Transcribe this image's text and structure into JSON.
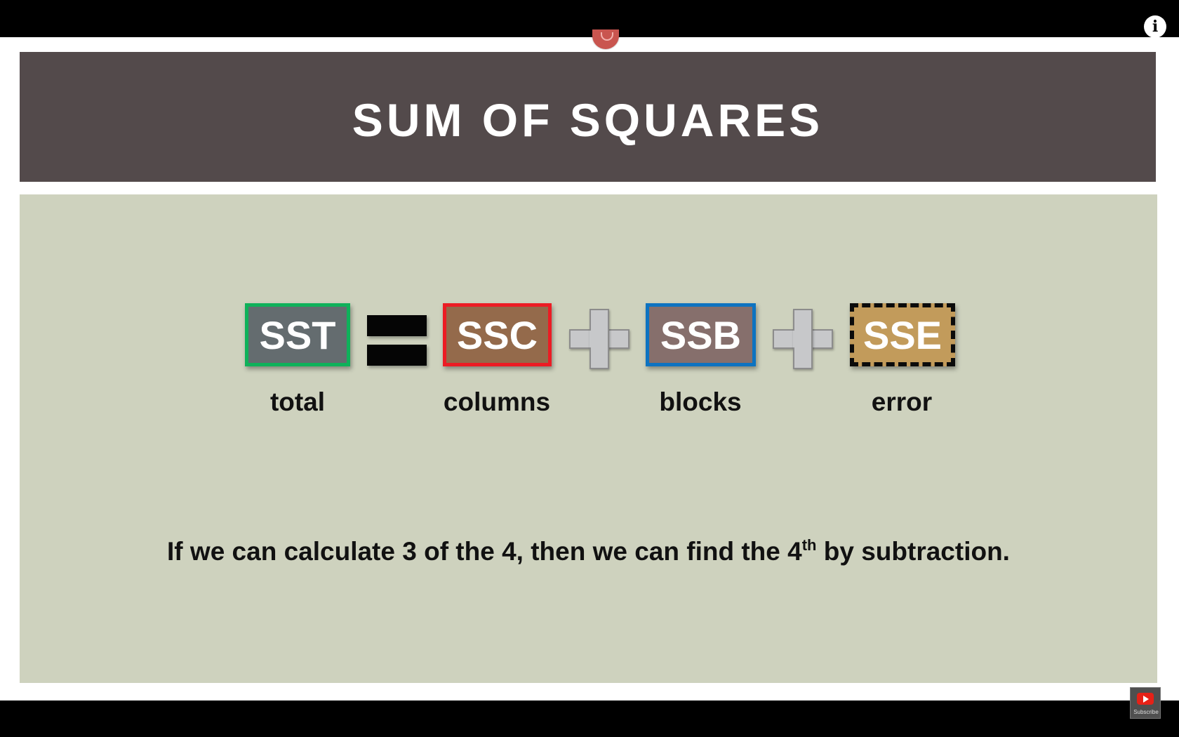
{
  "title": "SUM OF SQUARES",
  "terms": [
    {
      "abbr": "SST",
      "label": "total",
      "border_color": "#0fb15a",
      "fill_color": "#646c6f"
    },
    {
      "abbr": "SSC",
      "label": "columns",
      "border_color": "#ec1c24",
      "fill_color": "#946a4b"
    },
    {
      "abbr": "SSB",
      "label": "blocks",
      "border_color": "#0d73c1",
      "fill_color": "#866f6c"
    },
    {
      "abbr": "SSE",
      "label": "error",
      "border_color": "#0b0b0b",
      "fill_color": "#c29b5b"
    }
  ],
  "operators": [
    "equals-icon",
    "plus-icon",
    "plus-icon"
  ],
  "sentence": {
    "before": "If we can calculate 3 of the 4, then we can find the 4",
    "superscript": "th",
    "after": " by subtraction."
  },
  "player": {
    "info_icon": "i",
    "subscribe_label": "Subscribe"
  },
  "colors": {
    "title_bar": "#534a4b",
    "slide_background": "#ced2be"
  }
}
